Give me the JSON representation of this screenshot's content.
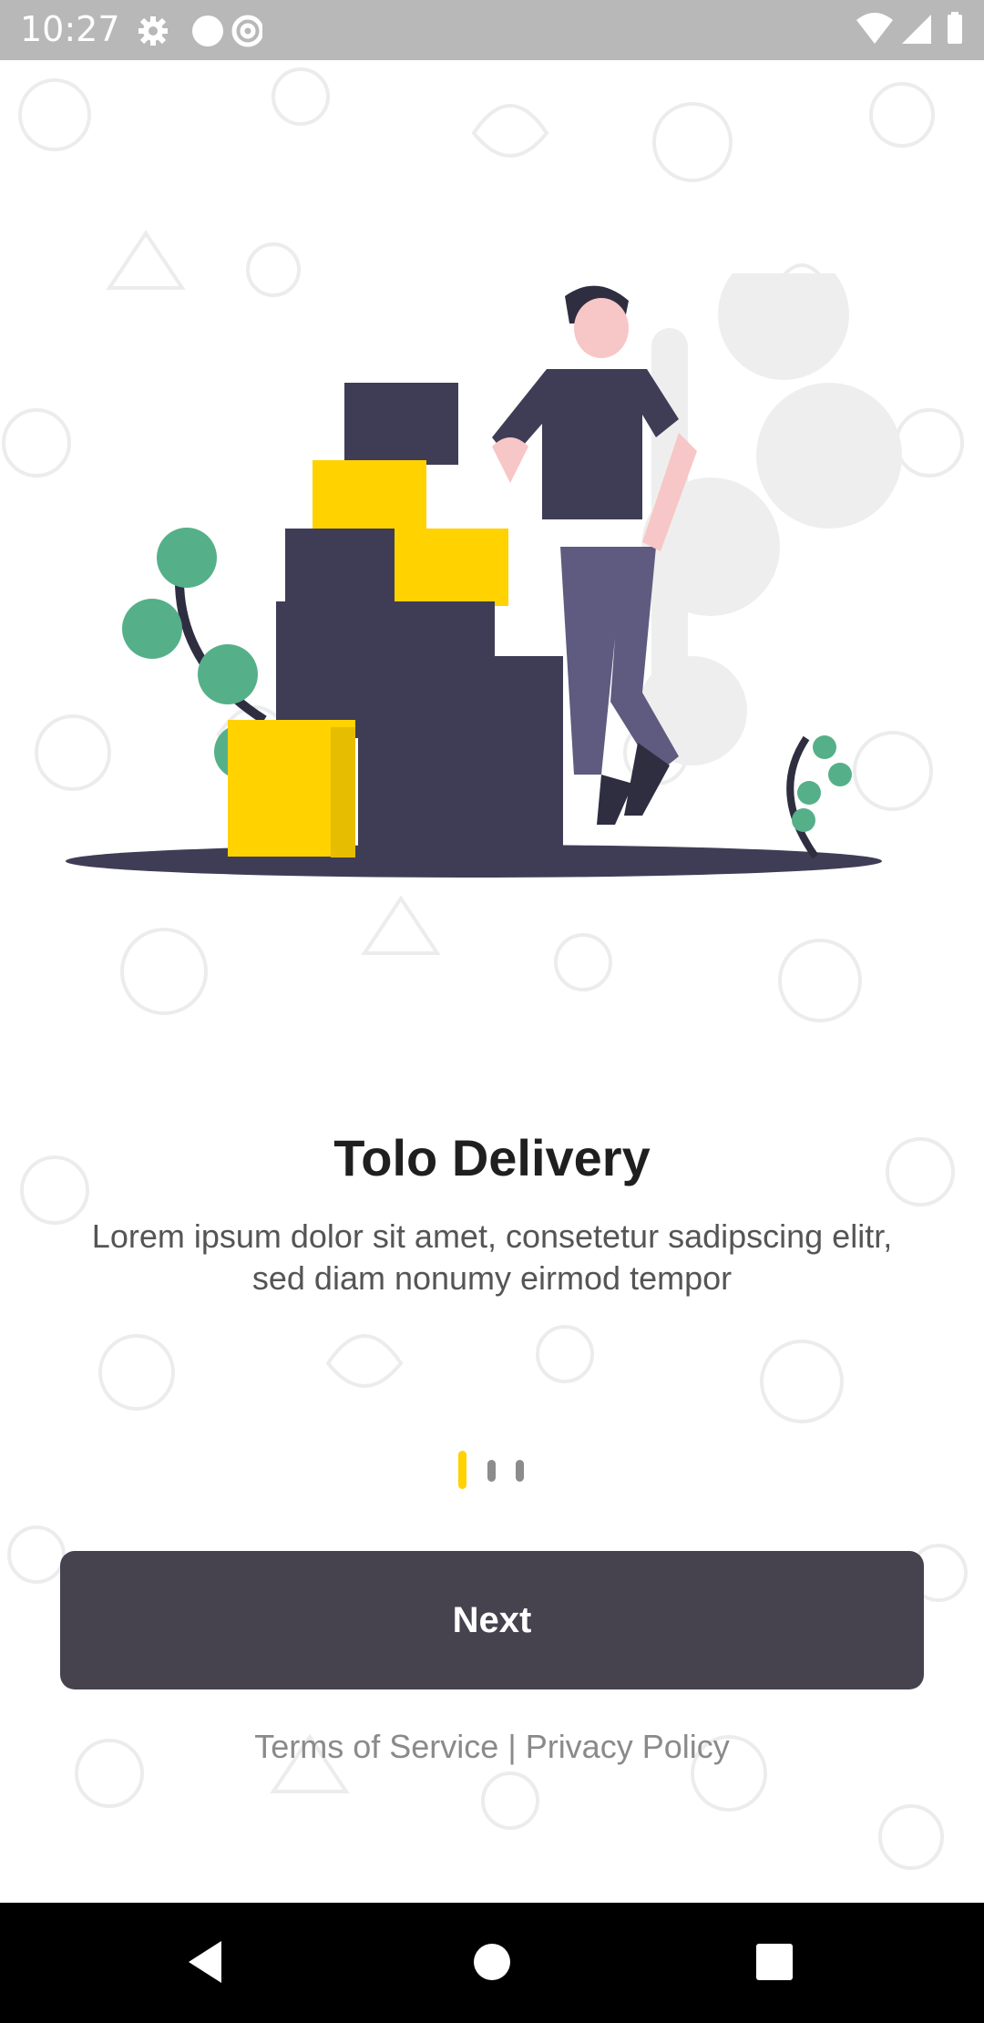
{
  "status_bar": {
    "time": "10:27",
    "left_icons": [
      "settings-gear-icon",
      "circle-icon",
      "at-sign-icon"
    ],
    "right_icons": [
      "wifi-icon",
      "cellular-signal-icon",
      "battery-icon"
    ]
  },
  "onboarding": {
    "title": "Tolo Delivery",
    "description": "Lorem ipsum dolor sit amet, consetetur sadipscing elitr, sed diam nonumy eirmod tempor",
    "pager": {
      "total": 3,
      "current": 1
    },
    "next_label": "Next",
    "terms_label": "Terms of Service",
    "separator": " | ",
    "privacy_label": "Privacy Policy"
  },
  "colors": {
    "accent": "#ffd200",
    "button": "#46434f",
    "dark": "#3f3d56",
    "plant": "#55b08a"
  },
  "nav_bar": {
    "icons": [
      "back-icon",
      "home-icon",
      "recents-icon"
    ]
  }
}
